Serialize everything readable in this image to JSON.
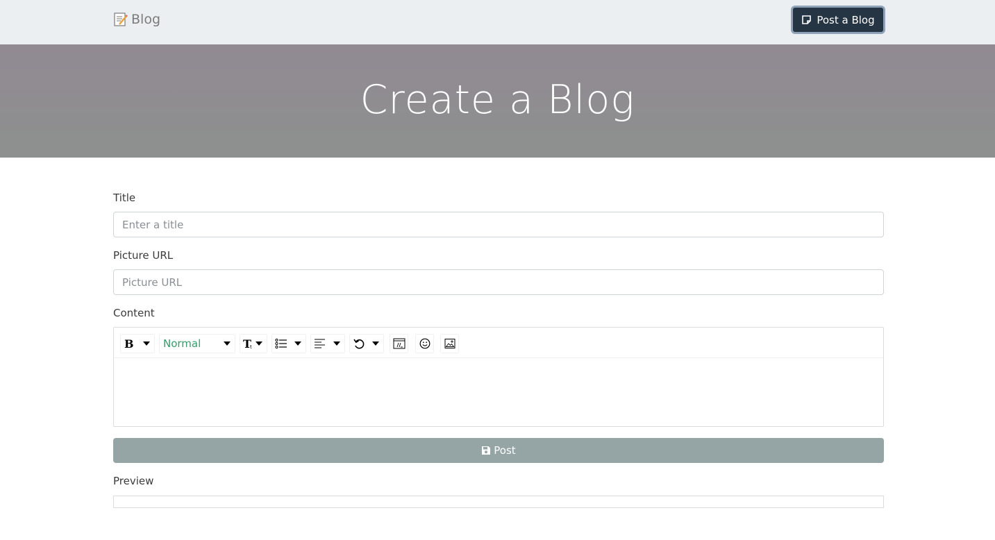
{
  "navbar": {
    "brand_label": "Blog",
    "brand_icon": "memo-icon",
    "post_button_label": "Post a Blog",
    "post_button_icon": "note-icon"
  },
  "hero": {
    "title": "Create a Blog"
  },
  "form": {
    "title_label": "Title",
    "title_placeholder": "Enter a title",
    "title_value": "",
    "picture_label": "Picture URL",
    "picture_placeholder": "Picture URL",
    "picture_value": "",
    "content_label": "Content",
    "toolbar": {
      "block_type": "Normal",
      "buttons": [
        "bold-icon",
        "font-size-icon",
        "list-icon",
        "align-left-icon",
        "undo-icon",
        "embed-icon",
        "emoji-icon",
        "image-icon"
      ]
    },
    "submit_label": "Post",
    "submit_icon": "save-icon",
    "preview_label": "Preview"
  },
  "colors": {
    "navbar_bg": "#eceff1",
    "post_button_bg": "#263544",
    "hero_bg": "#8f8d90",
    "submit_bg": "#95a5a6",
    "block_select_text": "#2f9e6a"
  }
}
